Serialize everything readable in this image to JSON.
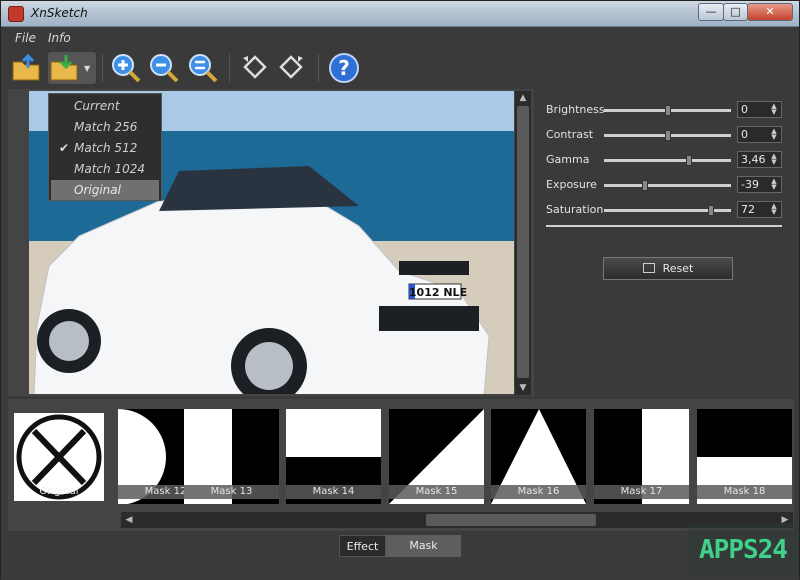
{
  "window": {
    "title": "XnSketch"
  },
  "menubar": {
    "file": "File",
    "info": "Info"
  },
  "dropdown": {
    "items": [
      {
        "label": "Current",
        "checked": false,
        "selected": false
      },
      {
        "label": "Match 256",
        "checked": false,
        "selected": false
      },
      {
        "label": "Match 512",
        "checked": true,
        "selected": false
      },
      {
        "label": "Match 1024",
        "checked": false,
        "selected": false
      },
      {
        "label": "Original",
        "checked": false,
        "selected": true
      }
    ]
  },
  "adjustments": [
    {
      "label": "Brightness",
      "value": "0",
      "level": 0.5
    },
    {
      "label": "Contrast",
      "value": "0",
      "level": 0.5
    },
    {
      "label": "Gamma",
      "value": "3,46",
      "level": 0.68
    },
    {
      "label": "Exposure",
      "value": "-39",
      "level": 0.31
    },
    {
      "label": "Saturation",
      "value": "72",
      "level": 0.86
    }
  ],
  "reset_label": "Reset",
  "thumbnails": {
    "original_label": "Original",
    "masks": [
      "Mask 12",
      "Mask 13",
      "Mask 14",
      "Mask 15",
      "Mask 16",
      "Mask 17",
      "Mask 18"
    ]
  },
  "photo": {
    "plate": "1012 NLE"
  },
  "tabs": {
    "effect": "Effect",
    "mask": "Mask"
  },
  "watermark": "APPS24",
  "colors": {
    "panel": "#3a3a3a",
    "accent_green": "#3fd18a",
    "help_blue": "#2f6fd6"
  }
}
